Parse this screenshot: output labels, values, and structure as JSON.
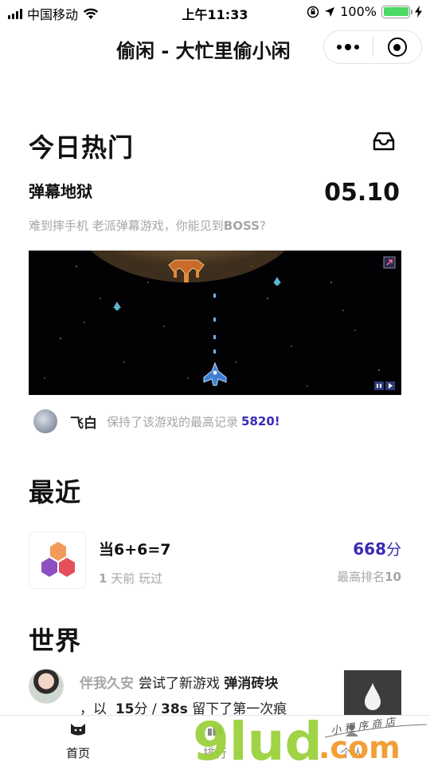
{
  "status_bar": {
    "carrier": "中国移动",
    "time": "上午11:33",
    "battery": "100%",
    "battery_level": 1.0
  },
  "nav": {
    "title": "偷闲 - 大忙里偷小闲"
  },
  "today": {
    "section_title": "今日热门",
    "game_name": "弹幕地狱",
    "date": "05.10",
    "desc_prefix": "难到摔手机 老派弹幕游戏，你能见到",
    "desc_boss": "BOSS",
    "desc_suffix": "?",
    "record_user": "飞白",
    "record_text": "保持了该游戏的最高记录",
    "record_score": "5820!"
  },
  "recent": {
    "section_title": "最近",
    "item": {
      "name": "当6+6=7",
      "played_num": "1",
      "played_text": "天前 玩过",
      "score": "668",
      "score_unit": "分",
      "rank_label": "最高排名",
      "rank_value": "10"
    }
  },
  "world": {
    "section_title": "世界",
    "item": {
      "user": "伴我久安",
      "action": "尝试了新游戏",
      "game": "弹消砖块",
      "line2_prefix": "，以",
      "score": "15",
      "score_unit": "分 /",
      "time": "38s",
      "line2_suffix": "留下了第一次痕"
    }
  },
  "tabs": [
    {
      "label": "首页",
      "icon": "cat-icon"
    },
    {
      "label": "排行",
      "icon": "ranking-icon"
    },
    {
      "label": "个人",
      "icon": "person-icon"
    }
  ],
  "watermark": {
    "brand": "9lud",
    "domain": ".com",
    "sub": "小程序商店"
  },
  "colors": {
    "accent": "#3a2bb5",
    "muted": "#a6a6a6",
    "battery": "#4cd964",
    "watermark_green": "#9bd13c",
    "watermark_orange": "#f29a2e"
  }
}
